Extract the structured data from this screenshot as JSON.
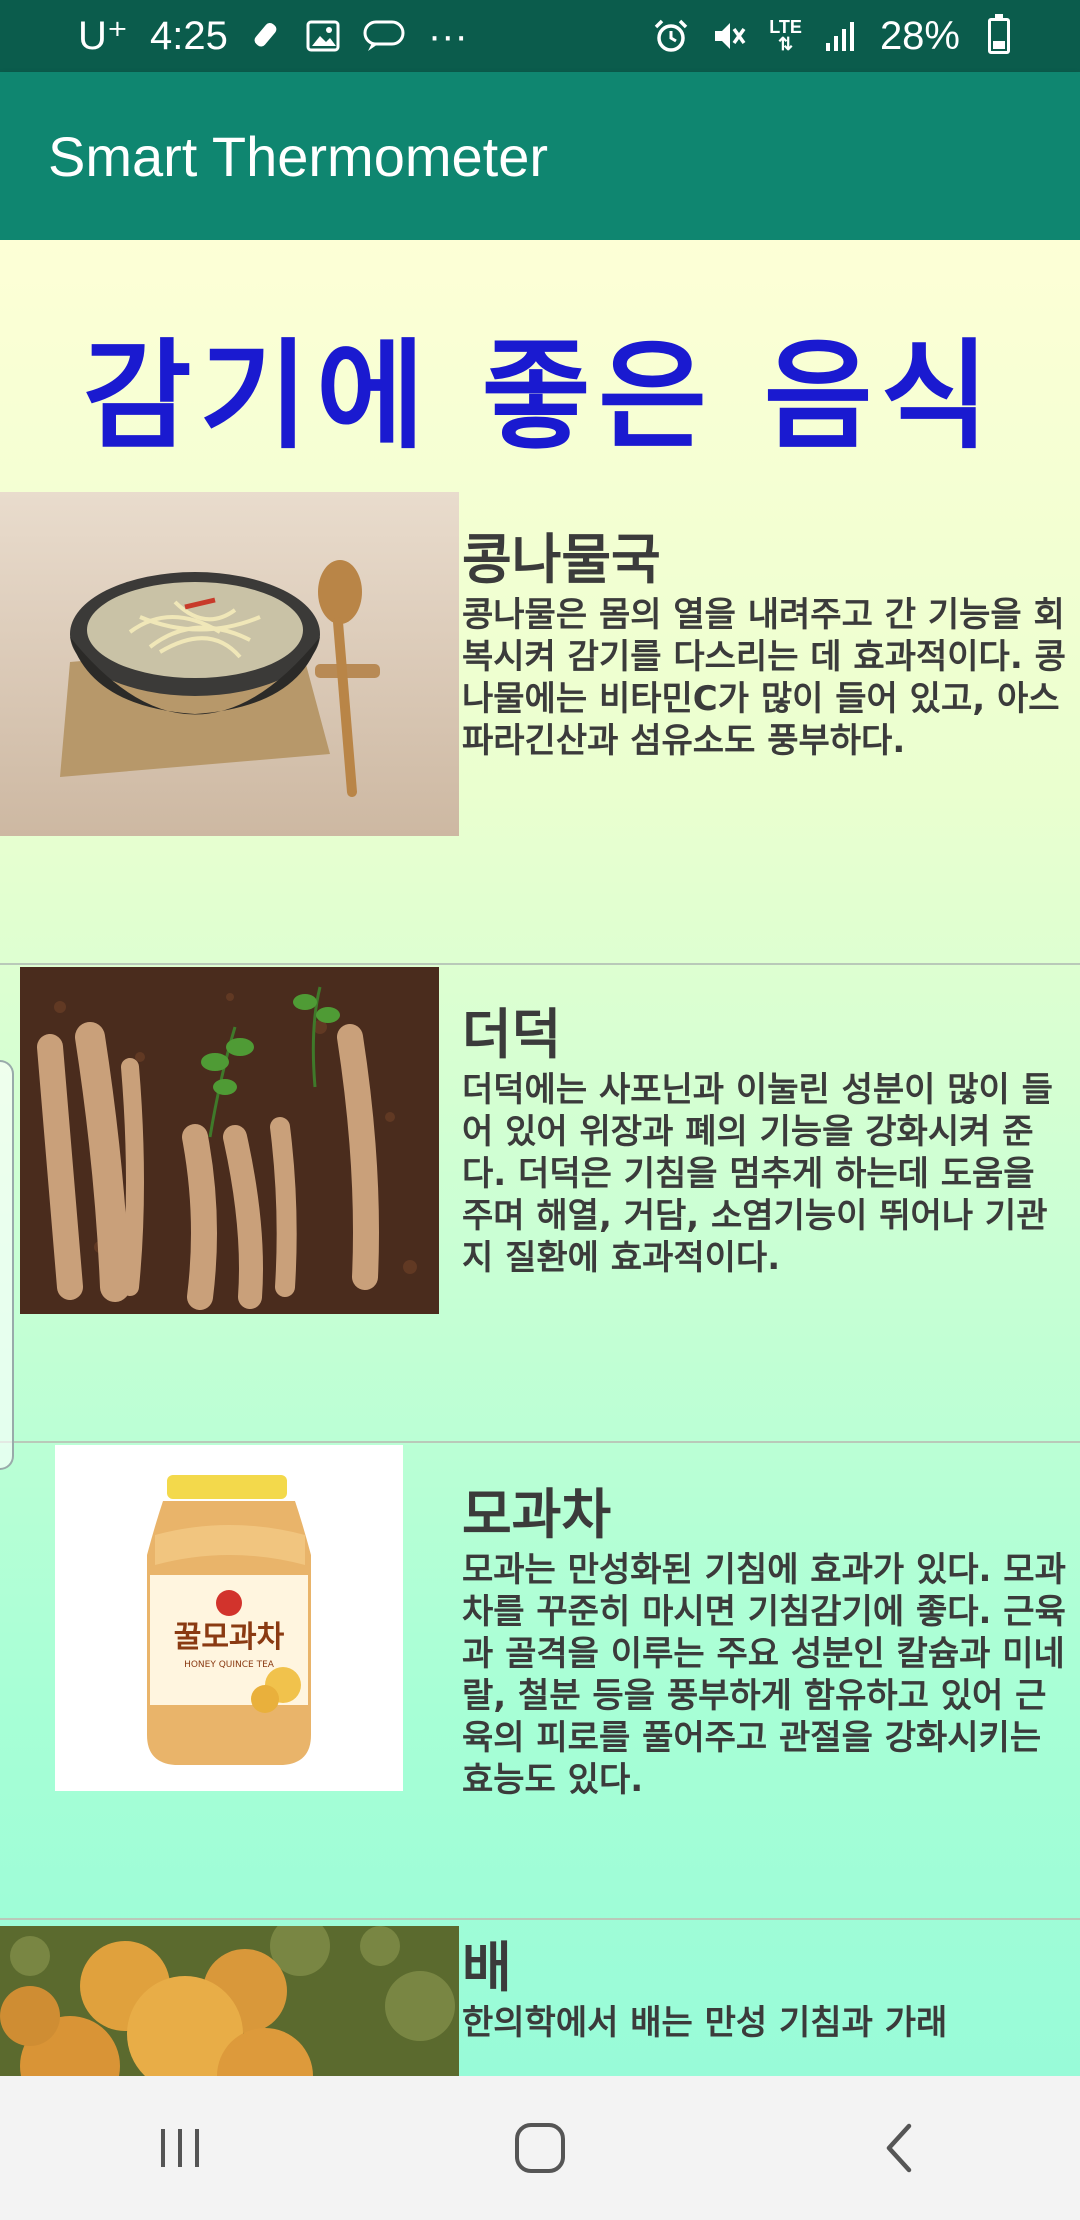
{
  "status_bar": {
    "carrier": "U⁺",
    "time": "4:25",
    "more": "···",
    "network": "LTE",
    "battery": "28%",
    "battery_level": 0.28,
    "icons": [
      "pencil-icon",
      "image-icon",
      "chat-bubble-icon",
      "alarm-icon",
      "mute-icon",
      "lte-icon",
      "signal-icon",
      "battery-icon"
    ]
  },
  "app_bar": {
    "title": "Smart Thermometer"
  },
  "page": {
    "heading": "감기에 좋은 음식"
  },
  "foods": [
    {
      "name": "콩나물국",
      "description": "콩나물은 몸의 열을 내려주고 간 기능을 회복시켜 감기를 다스리는 데 효과적이다. 콩나물에는 비타민C가 많이 들어 있고, 아스파라긴산과 섬유소도 풍부하다."
    },
    {
      "name": "더덕",
      "description": "더덕에는 사포닌과 이눌린 성분이 많이 들어 있어 위장과 폐의 기능을 강화시켜 준다. 더덕은 기침을 멈추게 하는데 도움을 주며 해열, 거담, 소염기능이 뛰어나 기관지 질환에 효과적이다."
    },
    {
      "name": "모과차",
      "description": "모과는 만성화된 기침에 효과가 있다. 모과차를 꾸준히 마시면 기침감기에 좋다. 근육과 골격을 이루는 주요 성분인 칼슘과 미네랄, 철분 등을 풍부하게 함유하고 있어 근육의 피로를 풀어주고 관절을 강화시키는 효능도 있다.",
      "jar_label": "꿀모과차",
      "jar_sublabel": "HONEY QUINCE TEA"
    },
    {
      "name": "배",
      "description": "한의학에서 배는 만성 기침과 가래"
    }
  ],
  "colors": {
    "status_bar": "#0b5c4c",
    "app_bar": "#0f8670",
    "heading": "#1a1ad0",
    "text": "#3b3b3b"
  }
}
